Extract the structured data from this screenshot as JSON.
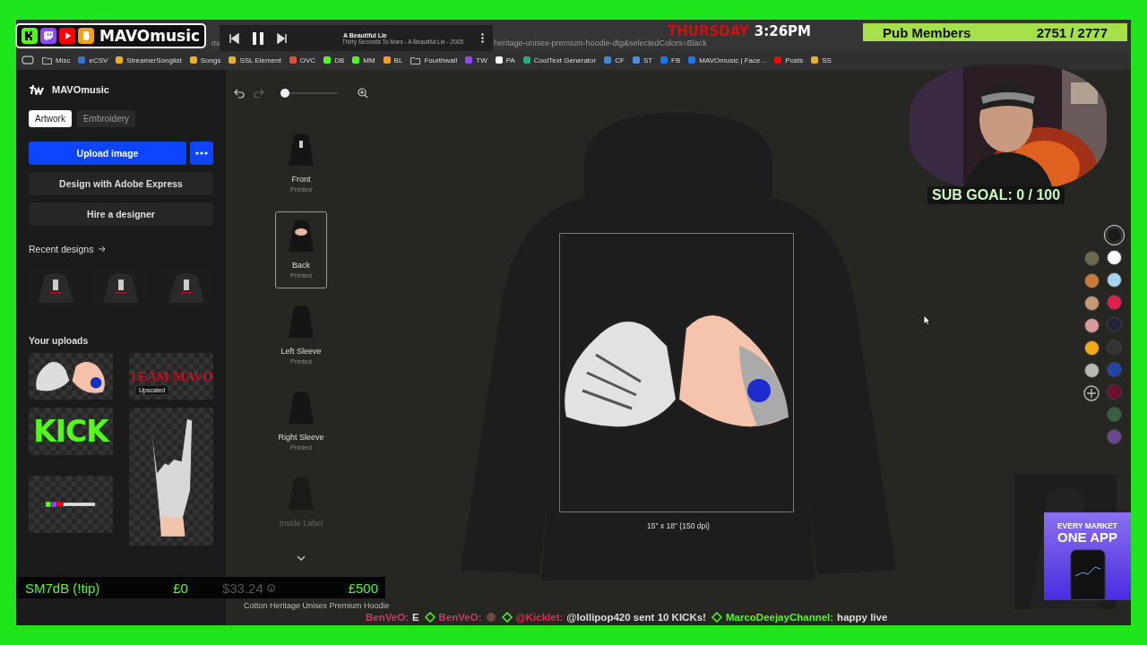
{
  "stream_logo": {
    "text": "MAVOmusic",
    "platforms": [
      {
        "kind": "kick",
        "color": "#53fc18"
      },
      {
        "kind": "twitch",
        "color": "#9146ff"
      },
      {
        "kind": "youtube",
        "color": "#ff0000"
      },
      {
        "kind": "b",
        "color": "#f0a020"
      }
    ]
  },
  "browser": {
    "url_prefix": "m/",
    "url": "heritage-unisex-premium-hoodie-dtg&selectedColors=Black",
    "bookmarks": [
      {
        "label": "Misc",
        "kind": "folder",
        "color": "#bbbbbb"
      },
      {
        "label": "eCSV",
        "kind": "site",
        "color": "#3b6fd8"
      },
      {
        "label": "StreamerSonglist",
        "kind": "site",
        "color": "#e8b020"
      },
      {
        "label": "Songs",
        "kind": "site",
        "color": "#e8b020"
      },
      {
        "label": "SSL Element",
        "kind": "site",
        "color": "#e8b020"
      },
      {
        "label": "OVC",
        "kind": "site",
        "color": "#e05030"
      },
      {
        "label": "DB",
        "kind": "site",
        "color": "#53fc18"
      },
      {
        "label": "MM",
        "kind": "site",
        "color": "#53fc18"
      },
      {
        "label": "BL",
        "kind": "site",
        "color": "#f0a020"
      },
      {
        "label": "Fourthwall",
        "kind": "folder",
        "color": "#bbbbbb"
      },
      {
        "label": "TW",
        "kind": "site",
        "color": "#9146ff"
      },
      {
        "label": "PA",
        "kind": "site",
        "color": "#ffffff"
      },
      {
        "label": "CoolText Generator",
        "kind": "site",
        "color": "#20b080"
      },
      {
        "label": "CF",
        "kind": "site",
        "color": "#3a8ad8"
      },
      {
        "label": "ST",
        "kind": "site",
        "color": "#4a90e2"
      },
      {
        "label": "FB",
        "kind": "site",
        "color": "#1877f2"
      },
      {
        "label": "MAVOmusic | Face...",
        "kind": "site",
        "color": "#1877f2"
      },
      {
        "label": "Posts",
        "kind": "site",
        "color": "#ff0000"
      },
      {
        "label": "SS",
        "kind": "site",
        "color": "#e8b020"
      }
    ]
  },
  "player": {
    "title": "A Beautiful Lie",
    "subtitle": "Thirty Seconds To Mars - A Beautiful Lie - 2005",
    "playing": true
  },
  "clock": {
    "day": "THURSDAY",
    "time": "3:26PM"
  },
  "members": {
    "label": "Pub Members",
    "count": "2751 / 2777"
  },
  "sub_goal": "SUB GOAL: 0 / 100",
  "sidebar": {
    "brand": "MAVOmusic",
    "tabs": [
      {
        "label": "Artwork",
        "selected": true
      },
      {
        "label": "Embroidery",
        "selected": false
      }
    ],
    "upload_button": "Upload image",
    "buttons": [
      "Design with Adobe Express",
      "Hire a designer"
    ],
    "recent_title": "Recent designs",
    "recent": [
      {
        "kind": "picture"
      },
      {
        "kind": "picture"
      },
      {
        "kind": "picture"
      }
    ],
    "uploads_title": "Your uploads",
    "uploads": [
      {
        "kind": "heart-hands"
      },
      {
        "kind": "text-art",
        "text": "TEAM MAVO",
        "badge": "Upscaled"
      },
      {
        "kind": "kick-art",
        "text": "KICK"
      },
      {
        "kind": "rock-hand"
      },
      {
        "kind": "logo-art"
      }
    ]
  },
  "toolbar": {
    "redo_disabled": true,
    "zoom": {
      "level": 0.0
    }
  },
  "views": [
    {
      "label": "Front",
      "status": "Printed",
      "selected": false,
      "faded": false
    },
    {
      "label": "Back",
      "status": "Printed",
      "selected": true,
      "faded": false
    },
    {
      "label": "Left Sleeve",
      "status": "Printed",
      "selected": false,
      "faded": false
    },
    {
      "label": "Right Sleeve",
      "status": "Printed",
      "selected": false,
      "faded": false
    },
    {
      "label": "Inside Label",
      "selected": false,
      "faded": true
    }
  ],
  "product_name": "Cotton Heritage Unisex Premium Hoodie",
  "canvas": {
    "print_size": "15\" x 18\" (150 dpi)"
  },
  "swatches_left": [
    {
      "color": "#6b6a4f",
      "selected": false
    },
    {
      "color": "#c97a3a",
      "selected": false
    },
    {
      "color": "#c49a74",
      "selected": false
    },
    {
      "color": "#d99a9a",
      "selected": false
    },
    {
      "color": "#f5a818",
      "selected": false
    },
    {
      "color": "#b8b8b0",
      "selected": false
    }
  ],
  "swatches_right": [
    {
      "color": "#1a1a1a",
      "selected": true
    },
    {
      "color": "#ffffff",
      "selected": false
    },
    {
      "color": "#a8d4f0",
      "selected": false
    },
    {
      "color": "#e0204a",
      "selected": false
    },
    {
      "color": "#22243a",
      "selected": false
    },
    {
      "color": "#333335",
      "selected": false
    },
    {
      "color": "#2244aa",
      "selected": false
    },
    {
      "color": "#6a1030",
      "selected": false
    },
    {
      "color": "#3a6040",
      "selected": false
    },
    {
      "color": "#6a4890",
      "selected": false
    }
  ],
  "tip_bar": {
    "label": "SM7dB (!tip)",
    "current": "£0",
    "price": "$33.24",
    "goal": "£500"
  },
  "chat": [
    {
      "kind": "plain",
      "user": "BenVeO:",
      "text": "E",
      "color": "#c04060"
    },
    {
      "kind": "badged-emote",
      "user": "BenVeO:",
      "color": "#c04060"
    },
    {
      "kind": "badged",
      "user": "@Kicklet:",
      "text": "@lollipop420 sent 10 KICKs!",
      "color": "#e03050"
    },
    {
      "kind": "badged",
      "user": "MarcoDeejayChannel:",
      "text": "happy live",
      "color": "#53fc18"
    }
  ],
  "ad": {
    "line1": "EVERY MARKET",
    "line2": "ONE APP"
  }
}
